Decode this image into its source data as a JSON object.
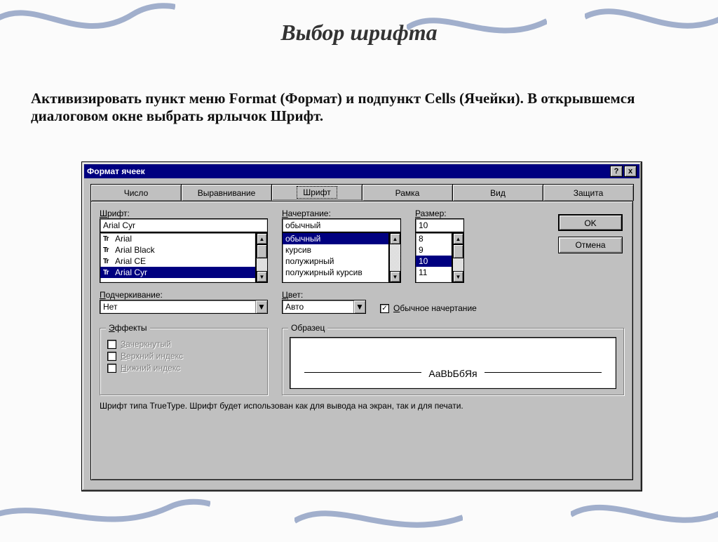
{
  "slide": {
    "title": "Выбор шрифта",
    "body": "Активизировать пункт меню Format (Формат) и подпункт Cells (Ячейки). В открывшемся диалоговом окне выбрать ярлычок Шрифт."
  },
  "dialog": {
    "title": "Формат ячеек",
    "help": "?",
    "close": "x",
    "tabs": [
      "Число",
      "Выравнивание",
      "Шрифт",
      "Рамка",
      "Вид",
      "Защита"
    ],
    "active_tab": 2,
    "buttons": {
      "ok": "OK",
      "cancel": "Отмена"
    },
    "font": {
      "label_pre": "Ш",
      "label_post": "рифт:",
      "value": "Arial Cyr",
      "list": [
        "Arial",
        "Arial Black",
        "Arial CE",
        "Arial Cyr"
      ],
      "selected_index": 3
    },
    "style": {
      "label_pre": "Н",
      "label_post": "ачертание:",
      "value": "обычный",
      "list": [
        "обычный",
        "курсив",
        "полужирный",
        "полужирный курсив"
      ],
      "selected_index": 0
    },
    "size": {
      "label_pre": "Р",
      "label_post": "азмер:",
      "value": "10",
      "list": [
        "8",
        "9",
        "10",
        "11"
      ],
      "selected_index": 2
    },
    "underline": {
      "label_pre": "П",
      "label_post": "одчеркивание:",
      "value": "Нет"
    },
    "color": {
      "label_pre": "Ц",
      "label_post": "вет:",
      "value": "Авто"
    },
    "normal_font": {
      "label_pre": "О",
      "label_post": "бычное начертание",
      "checked": true
    },
    "effects": {
      "title_pre": "Э",
      "title_post": "ффекты",
      "strike_pre": "З",
      "strike_post": "ачеркнутый",
      "super_pre": "В",
      "super_post": "ерхний индекс",
      "sub_pre": "Н",
      "sub_post": "ижний индекс"
    },
    "preview": {
      "title": "Образец",
      "sample": "AaBbБбЯя"
    },
    "footnote": "Шрифт типа TrueType. Шрифт будет использован как для вывода на экран, так и для печати."
  }
}
